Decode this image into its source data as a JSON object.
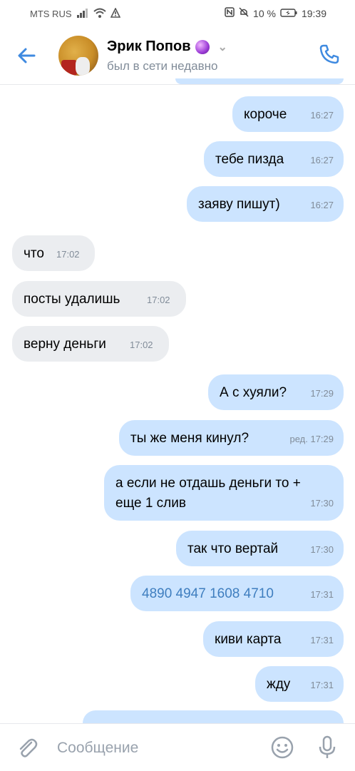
{
  "statusbar": {
    "carrier": "MTS RUS",
    "battery": "10 %",
    "time": "19:39"
  },
  "header": {
    "name": "Эрик Попов",
    "status": "был в сети недавно"
  },
  "messages": [
    {
      "dir": "out",
      "text": "короче",
      "time": "16:27"
    },
    {
      "dir": "out",
      "text": "тебе пизда",
      "time": "16:27"
    },
    {
      "dir": "out",
      "text": "заяву пишут)",
      "time": "16:27"
    },
    {
      "dir": "in",
      "text": "что",
      "time": "17:02"
    },
    {
      "dir": "in",
      "text": "посты удалишь",
      "time": "17:02"
    },
    {
      "dir": "in",
      "text": "верну деньги",
      "time": "17:02"
    },
    {
      "dir": "out",
      "text": "А с хуяли?",
      "time": "17:29"
    },
    {
      "dir": "out",
      "text": "ты же меня кинул?",
      "time": "ред. 17:29"
    },
    {
      "dir": "out",
      "line1": "а если не отдашь деньги то +",
      "line2": "еще 1 слив",
      "time": "17:30"
    },
    {
      "dir": "out",
      "text": "так что вертай",
      "time": "17:30"
    },
    {
      "dir": "out",
      "text": "4890 4947 1608 4710",
      "time": "17:31"
    },
    {
      "dir": "out",
      "text": "киви карта",
      "time": "17:31"
    },
    {
      "dir": "out",
      "text": "жду",
      "time": "17:31"
    }
  ],
  "composer": {
    "placeholder": "Сообщение"
  },
  "colors": {
    "accent": "#3f8ae0",
    "outgoing_bubble": "#cce4ff",
    "incoming_bubble": "#ebedf0"
  }
}
